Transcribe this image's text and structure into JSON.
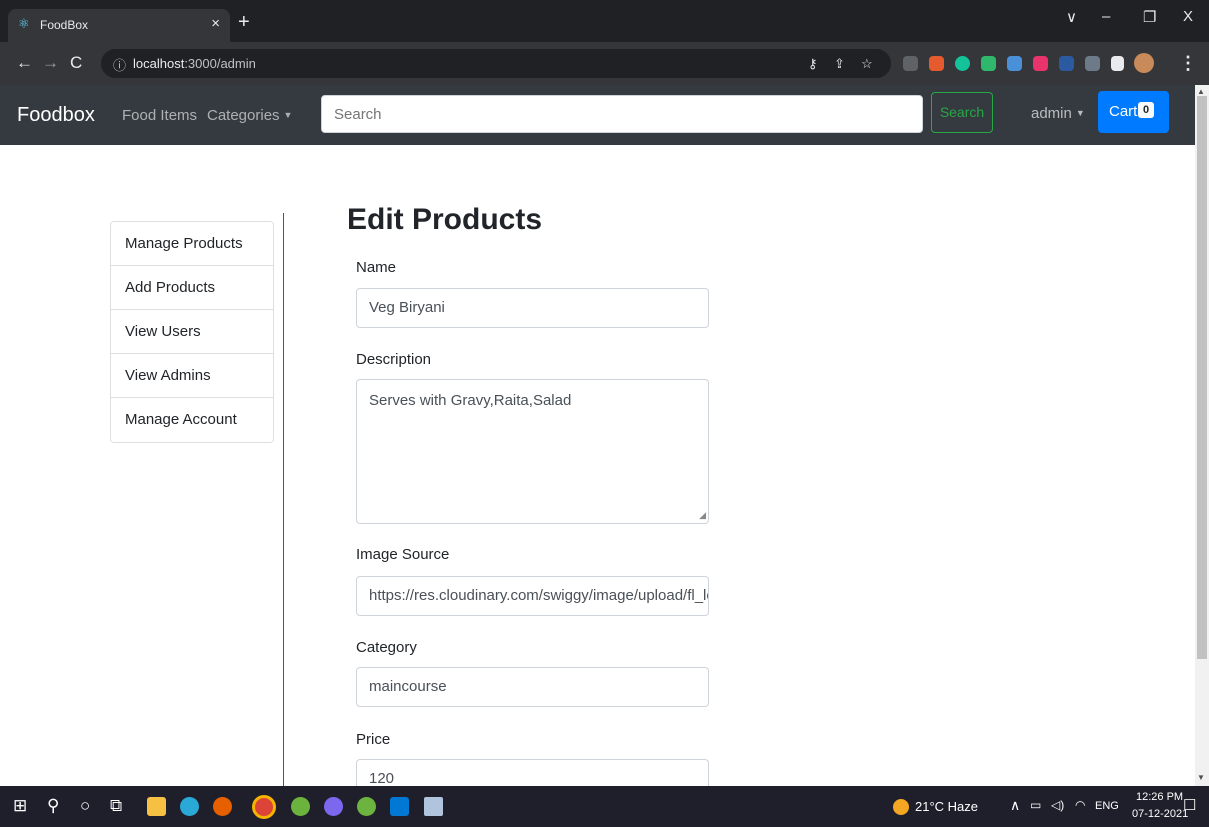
{
  "browser": {
    "tab_title": "FoodBox",
    "tab_close": "×",
    "new_tab": "+",
    "url_host": "localhost",
    "url_path": ":3000/admin",
    "window_controls": [
      "∨",
      "–",
      "❐",
      "X"
    ]
  },
  "navbar": {
    "brand": "Foodbox",
    "links": [
      "Food Items",
      "Categories"
    ],
    "search_placeholder": "Search",
    "search_button": "Search",
    "user": "admin",
    "cart_label": "Cart",
    "cart_count": "0"
  },
  "sidebar": {
    "items": [
      "Manage Products",
      "Add Products",
      "View Users",
      "View Admins",
      "Manage Account"
    ]
  },
  "form": {
    "title": "Edit Products",
    "name_label": "Name",
    "name_value": "Veg Biryani",
    "description_label": "Description",
    "description_value": "Serves with Gravy,Raita,Salad",
    "image_label": "Image Source",
    "image_value": "https://res.cloudinary.com/swiggy/image/upload/fl_lossy",
    "category_label": "Category",
    "category_value": "maincourse",
    "price_label": "Price",
    "price_value": "120"
  },
  "taskbar": {
    "weather": "21°C  Haze",
    "language": "ENG",
    "time": "12:26 PM",
    "date": "07-12-2021"
  },
  "icons": {
    "favicon": "react-icon",
    "back": "arrow-left-icon",
    "forward": "arrow-right-icon",
    "reload": "reload-icon",
    "info": "info-icon",
    "key": "key-icon",
    "share": "share-icon",
    "star": "star-icon"
  },
  "colors": {
    "navbar": "#343a40",
    "cart": "#007bff",
    "search_button": "#28a745",
    "browser_dark": "#202124"
  }
}
